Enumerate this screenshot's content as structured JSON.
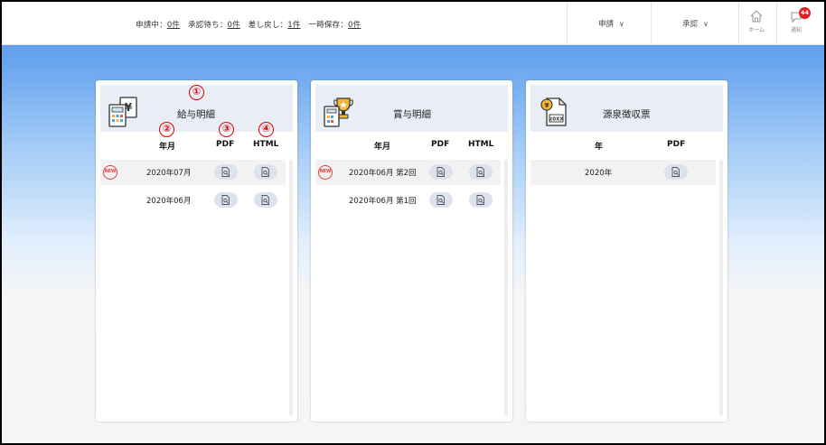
{
  "header": {
    "status": [
      {
        "label": "申請中：",
        "count": "0件"
      },
      {
        "label": "承認待ち：",
        "count": "0件"
      },
      {
        "label": "差し戻し：",
        "count": "1件"
      },
      {
        "label": "一時保存：",
        "count": "0件"
      }
    ],
    "menus": [
      {
        "label": "申請"
      },
      {
        "label": "承認"
      }
    ],
    "home_label": "ホーム",
    "notify_label": "通知",
    "notify_count": "44"
  },
  "cards": [
    {
      "title": "給与明細",
      "icon": "payslip-calculator-icon",
      "columns": [
        "年月",
        "PDF",
        "HTML"
      ],
      "rows": [
        {
          "new": true,
          "label": "2020年07月"
        },
        {
          "new": false,
          "label": "2020年06月"
        }
      ]
    },
    {
      "title": "賞与明細",
      "icon": "bonus-trophy-icon",
      "columns": [
        "年月",
        "PDF",
        "HTML"
      ],
      "rows": [
        {
          "new": true,
          "label": "2020年06月 第2回"
        },
        {
          "new": false,
          "label": "2020年06月 第1回"
        }
      ]
    },
    {
      "title": "源泉徴収票",
      "icon": "withholding-document-icon",
      "columns": [
        "年",
        "PDF"
      ],
      "rows": [
        {
          "new": false,
          "label": "2020年"
        }
      ]
    }
  ],
  "new_badge": "NEW",
  "markers": [
    "①",
    "②",
    "③",
    "④"
  ],
  "colors": {
    "accent_blue": "#4d8fe6",
    "badge_red": "#e02020",
    "marker_red": "#e00000"
  }
}
